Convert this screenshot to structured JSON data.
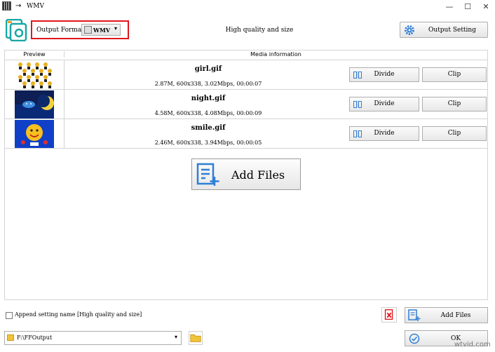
{
  "window": {
    "title": "WMV",
    "title_arrow": "→",
    "minimize": "—",
    "maximize": "☐",
    "close": "✕"
  },
  "toolbar": {
    "format_label": "Output Format",
    "format_value": "WMV",
    "quality_text": "High quality and size",
    "output_setting_label": "Output Setting"
  },
  "table": {
    "col_preview": "Preview",
    "col_media": "Media information",
    "rows": [
      {
        "name": "girl.gif",
        "meta": "2.87M, 600x338, 3.02Mbps, 00:00:07",
        "divide": "Divide",
        "clip": "Clip",
        "thumb": "girl"
      },
      {
        "name": "night.gif",
        "meta": "4.58M, 600x338, 4.08Mbps, 00:00:09",
        "divide": "Divide",
        "clip": "Clip",
        "thumb": "night"
      },
      {
        "name": "smile.gif",
        "meta": "2.46M, 600x338, 3.94Mbps, 00:00:05",
        "divide": "Divide",
        "clip": "Clip",
        "thumb": "smile"
      }
    ]
  },
  "add_files_big": "Add Files",
  "bottom": {
    "append_label": "Append setting name [High quality and size]",
    "add_files_label": "Add Files",
    "path_value": "F:\\FFOutput",
    "ok_label": "OK"
  },
  "watermark": "wtvid.com",
  "colors": {
    "accent_teal": "#1aa6a6",
    "icon_blue": "#2f7fd6",
    "highlight_red": "#e0161e"
  }
}
